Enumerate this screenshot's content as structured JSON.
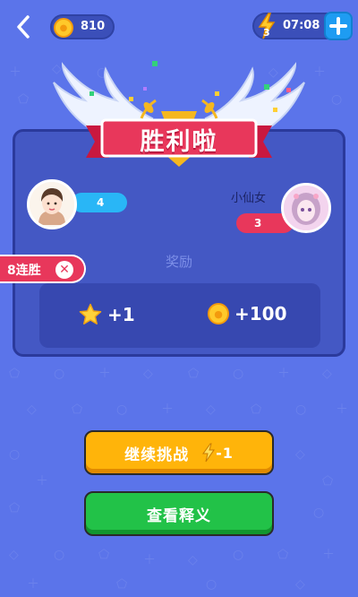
{
  "topbar": {
    "coins": "810",
    "energy_count": "3",
    "energy_timer": "07:08"
  },
  "result": {
    "title": "胜利啦",
    "player_left": {
      "score": "4"
    },
    "player_right": {
      "name": "小仙女",
      "score": "3"
    },
    "streak": "8连胜",
    "reward_label": "奖励",
    "rewards": {
      "stars": "+1",
      "coins": "+100"
    }
  },
  "buttons": {
    "continue_label": "继续挑战",
    "continue_cost": "-1",
    "view_label": "查看释义"
  },
  "colors": {
    "background": "#5b74ea",
    "card": "#4458c4",
    "banner": "#e8375b",
    "continue": "#ffb40a",
    "view": "#22c248"
  }
}
